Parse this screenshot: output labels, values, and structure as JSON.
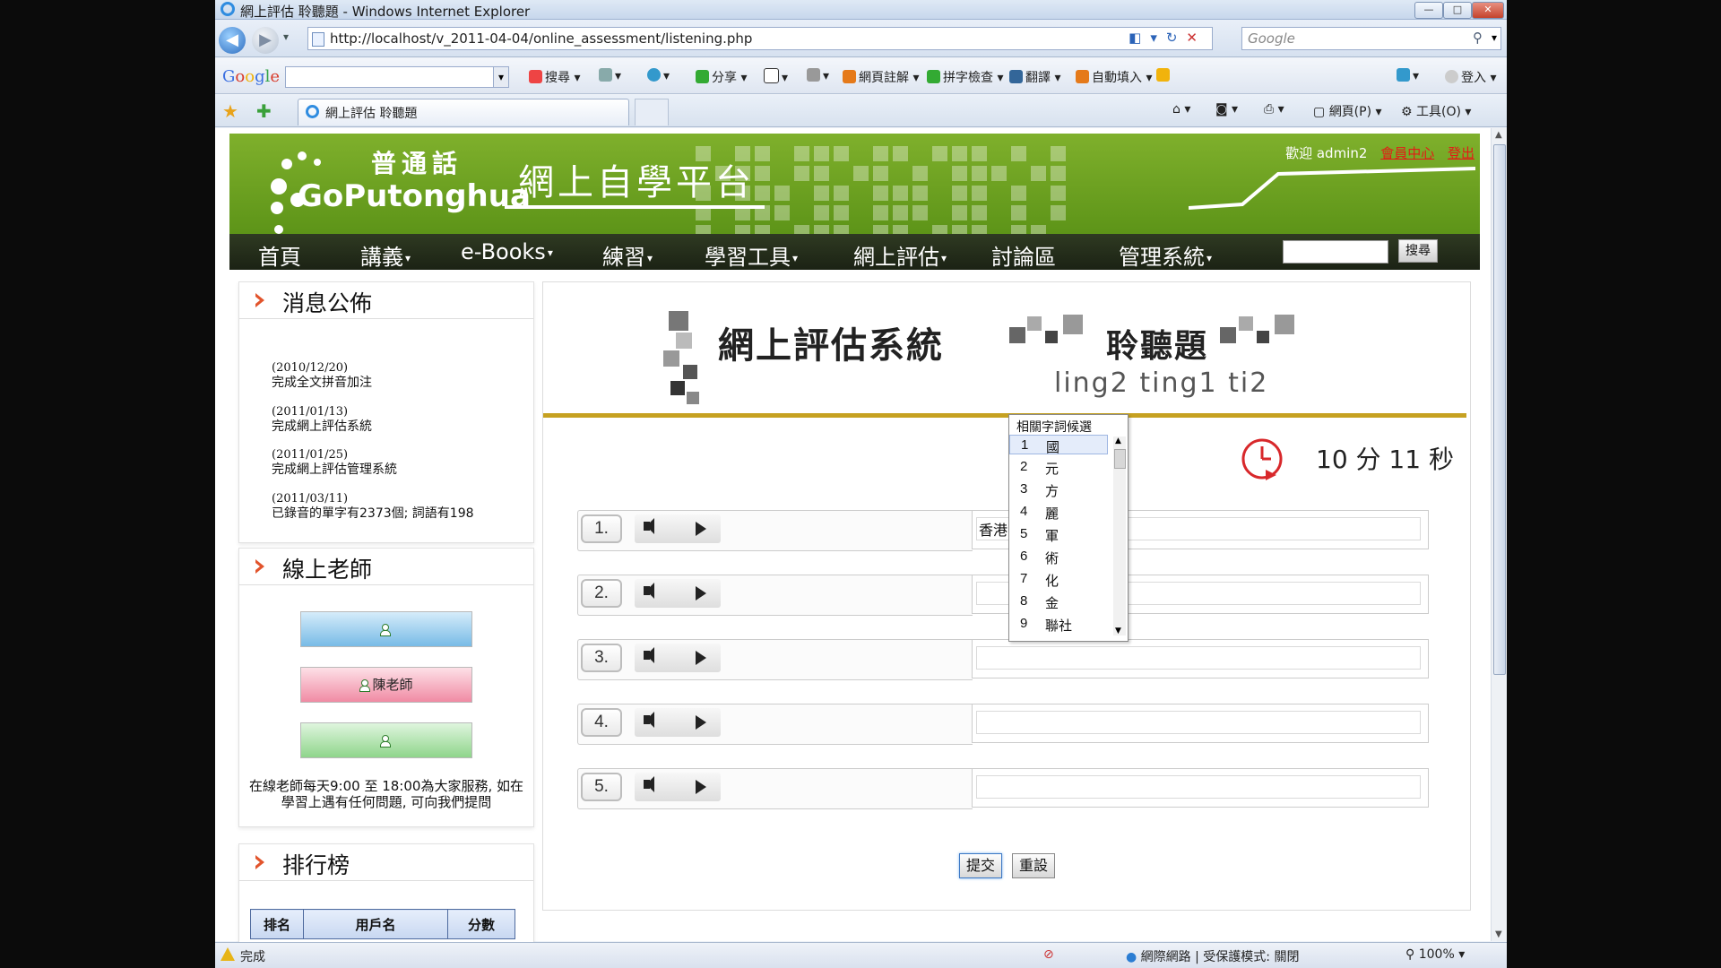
{
  "window": {
    "title": "網上評估 聆聽題 - Windows Internet Explorer",
    "min": "—",
    "max": "□",
    "close": "✕"
  },
  "address": {
    "url": "http://localhost/v_2011-04-04/online_assessment/listening.php",
    "search_placeholder": "Google"
  },
  "google_toolbar": {
    "logo": "Google",
    "items": [
      "搜尋",
      "分享",
      "網頁註解",
      "拼字檢查",
      "翻譯",
      "自動填入"
    ],
    "login": "登入"
  },
  "tab": {
    "title": "網上評估 聆聽題"
  },
  "commands": {
    "page": "網頁(P)",
    "tools": "工具(O)"
  },
  "site": {
    "brand_cn": "普通話",
    "brand_en": "GoPutonghua",
    "platform": "網上自學平台",
    "welcome": "歡迎 admin2",
    "member_center": "會員中心",
    "logout": "登出",
    "menu": [
      "首頁",
      "講義",
      "e-Books",
      "練習",
      "學習工具",
      "網上評估",
      "討論區",
      "管理系統"
    ],
    "search_btn": "搜尋"
  },
  "news": {
    "title": "消息公佈",
    "items": [
      {
        "date": "(2010/12/20)",
        "text": "完成全文拼音加注"
      },
      {
        "date": "(2011/01/13)",
        "text": "完成網上評估系統"
      },
      {
        "date": "(2011/01/25)",
        "text": "完成網上評估管理系統"
      },
      {
        "date": "(2011/03/11)",
        "text": "已錄音的單字有2373個; 詞語有198"
      }
    ]
  },
  "teachers": {
    "title": "線上老師",
    "buttons": [
      "",
      "陳老師",
      ""
    ],
    "service": "在線老師每天9:00 至 18:00為大家服務, 如在學習上遇有任何問題, 可向我們提問"
  },
  "ranking": {
    "title": "排行榜",
    "columns": [
      "排名",
      "用戶名",
      "分數"
    ]
  },
  "exam": {
    "title": "網上評估系統",
    "type": "聆聽題",
    "pinyin": "ling2 ting1 ti2",
    "timer": "10 分 11 秒",
    "questions": [
      {
        "num": "1.",
        "answer": "香港的夜景真是很美"
      },
      {
        "num": "2.",
        "answer": ""
      },
      {
        "num": "3.",
        "answer": ""
      },
      {
        "num": "4.",
        "answer": ""
      },
      {
        "num": "5.",
        "answer": ""
      }
    ],
    "submit": "提交",
    "reset": "重設"
  },
  "ime": {
    "header": "相關字詞候選",
    "candidates": [
      {
        "n": "1",
        "c": "國"
      },
      {
        "n": "2",
        "c": "元"
      },
      {
        "n": "3",
        "c": "方"
      },
      {
        "n": "4",
        "c": "麗"
      },
      {
        "n": "5",
        "c": "軍"
      },
      {
        "n": "6",
        "c": "術"
      },
      {
        "n": "7",
        "c": "化"
      },
      {
        "n": "8",
        "c": "金"
      },
      {
        "n": "9",
        "c": "聯社"
      }
    ]
  },
  "status": {
    "text": "完成",
    "zone": "網際網路 | 受保護模式: 關閉",
    "zoom": "100%"
  },
  "colors": {
    "banner_green": "#6aa020",
    "menu_dark": "#232b19",
    "accent_gold": "#c6a121",
    "heading_arrow": "#e2542c"
  }
}
